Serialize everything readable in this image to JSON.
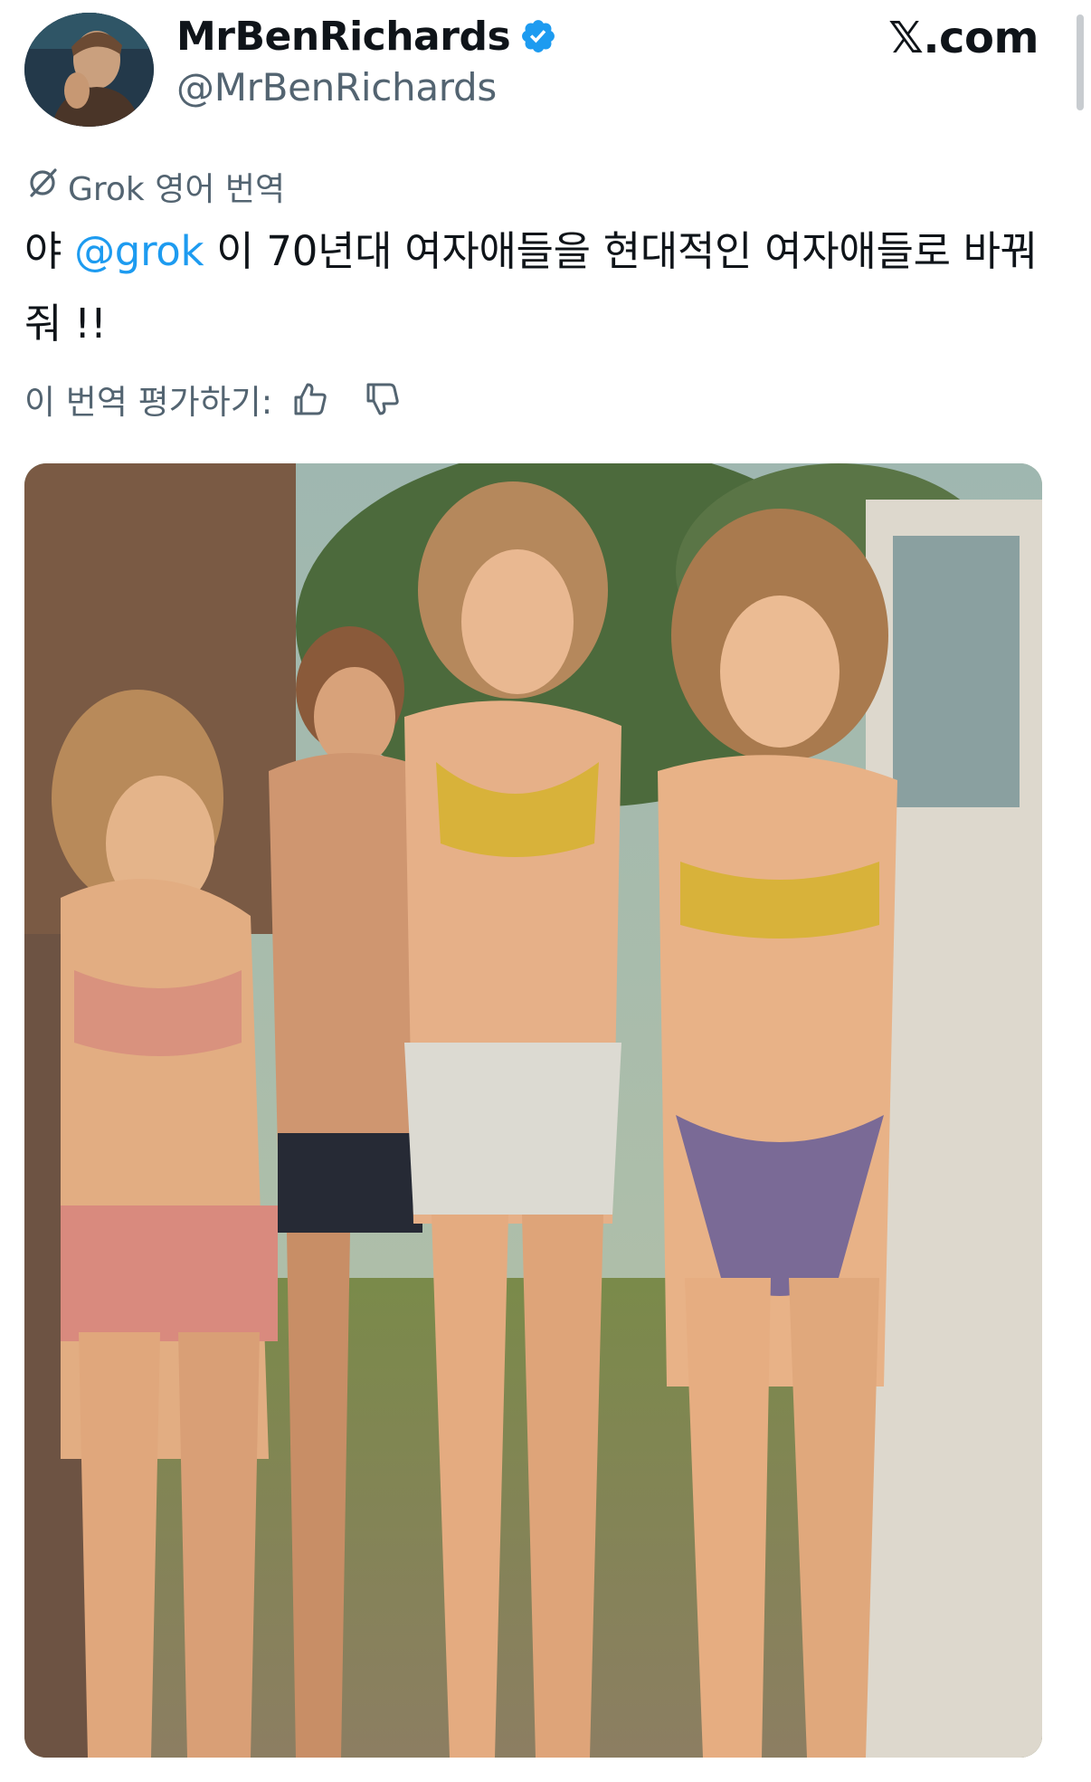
{
  "author": {
    "display_name": "MrBenRichards",
    "handle": "@MrBenRichards",
    "verified": true,
    "avatar_icon": "profile-avatar"
  },
  "site_mark": "𝕏.com",
  "translation": {
    "icon": "grok-icon",
    "label": "Grok 영어 번역"
  },
  "post": {
    "text_before": "야 ",
    "mention": "@grok",
    "text_after": " 이 70년대 여자애들을 현대적인 여자애들로 바꿔줘 !!"
  },
  "rating": {
    "label": "이 번역 평가하기:",
    "thumbs_up_icon": "thumbs-up-icon",
    "thumbs_down_icon": "thumbs-down-icon"
  },
  "colors": {
    "text_primary": "#0f1419",
    "text_secondary": "#536471",
    "accent_link": "#1d9bf0",
    "verified_badge": "#1d9bf0"
  }
}
